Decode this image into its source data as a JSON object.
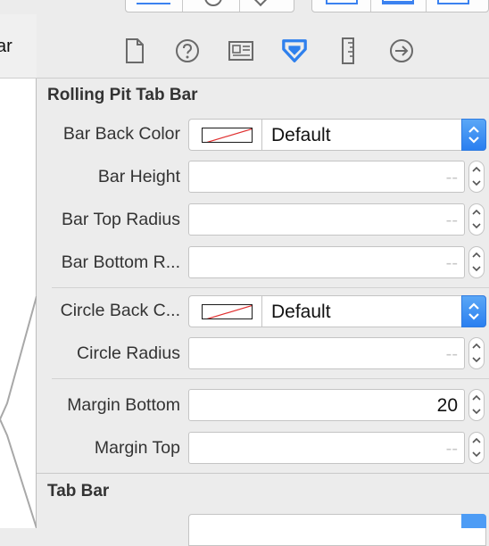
{
  "left_pane": {
    "tab_text": "ar"
  },
  "inspector": {
    "tabs": [
      {
        "name": "file-inspector-icon"
      },
      {
        "name": "quick-help-icon"
      },
      {
        "name": "identity-inspector-icon"
      },
      {
        "name": "attributes-inspector-icon",
        "active": true
      },
      {
        "name": "size-inspector-icon"
      },
      {
        "name": "connections-inspector-icon"
      }
    ],
    "section1": {
      "title": "Rolling Pit Tab Bar",
      "bar_back_color": {
        "label": "Bar Back Color",
        "value": "Default"
      },
      "bar_height": {
        "label": "Bar Height",
        "placeholder": "--"
      },
      "bar_top_radius": {
        "label": "Bar Top Radius",
        "placeholder": "--"
      },
      "bar_bottom_radius": {
        "label": "Bar Bottom R...",
        "placeholder": "--"
      },
      "circle_back_color": {
        "label": "Circle Back C...",
        "value": "Default"
      },
      "circle_radius": {
        "label": "Circle Radius",
        "placeholder": "--"
      },
      "margin_bottom": {
        "label": "Margin Bottom",
        "value": "20"
      },
      "margin_top": {
        "label": "Margin Top",
        "placeholder": "--"
      }
    },
    "section2": {
      "title": "Tab Bar"
    }
  },
  "colors": {
    "accent": "#2a7ff0",
    "background": "#ececec"
  }
}
